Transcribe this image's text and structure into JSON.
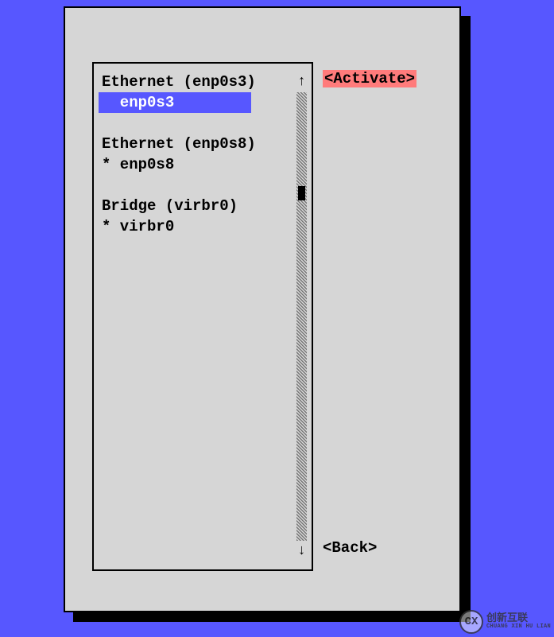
{
  "list": {
    "group1_header": "Ethernet (enp0s3)",
    "group1_item": "  enp0s3",
    "group2_header": "Ethernet (enp0s8)",
    "group2_item": "* enp0s8",
    "group3_header": "Bridge (virbr0)",
    "group3_item": "* virbr0"
  },
  "scroll": {
    "up_arrow": "↑",
    "down_arrow": "↓"
  },
  "buttons": {
    "activate": "<Activate>",
    "back": "<Back>"
  },
  "watermark": {
    "icon": "CX",
    "line1": "创新互联",
    "line2": "CHUANG XIN HU LIAN"
  }
}
